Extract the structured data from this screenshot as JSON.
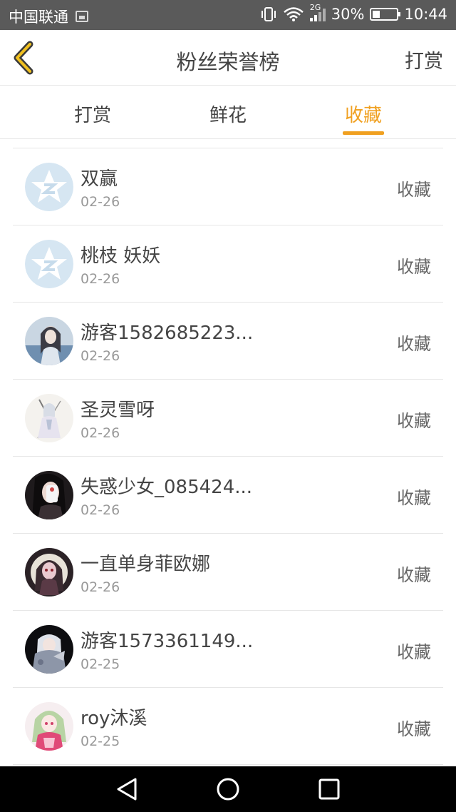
{
  "status_bar": {
    "carrier": "中国联通",
    "network": "2G",
    "battery_text": "30%",
    "battery_level": 0.3,
    "time": "10:44",
    "icons": [
      "image-notification-icon",
      "vibrate-icon",
      "wifi-icon",
      "cell-signal-icon",
      "battery-icon"
    ]
  },
  "nav": {
    "title": "粉丝荣誉榜",
    "action": "打赏",
    "back_icon": "chevron-left-icon",
    "accent_color": "#f0a020"
  },
  "tabs": [
    {
      "label": "打赏",
      "active": false
    },
    {
      "label": "鲜花",
      "active": false
    },
    {
      "label": "收藏",
      "active": true
    }
  ],
  "fans": [
    {
      "name": "双赢",
      "date": "02-26",
      "action": "收藏",
      "avatar": "default-star-avatar"
    },
    {
      "name": "桃枝 妖妖",
      "date": "02-26",
      "action": "收藏",
      "avatar": "default-star-avatar"
    },
    {
      "name": "游客1582685223...",
      "date": "02-26",
      "action": "收藏",
      "avatar": "photo-avatar"
    },
    {
      "name": "圣灵雪呀",
      "date": "02-26",
      "action": "收藏",
      "avatar": "anime-girl-avatar"
    },
    {
      "name": "失惑少女_085424...",
      "date": "02-26",
      "action": "收藏",
      "avatar": "photo-avatar"
    },
    {
      "name": "一直单身菲欧娜",
      "date": "02-26",
      "action": "收藏",
      "avatar": "anime-girl-avatar"
    },
    {
      "name": "游客1573361149...",
      "date": "02-25",
      "action": "收藏",
      "avatar": "anime-girl-avatar"
    },
    {
      "name": "roy沐溪",
      "date": "02-25",
      "action": "收藏",
      "avatar": "anime-girl-avatar"
    }
  ],
  "system_nav": [
    "back-triangle-icon",
    "home-circle-icon",
    "recents-square-icon"
  ]
}
